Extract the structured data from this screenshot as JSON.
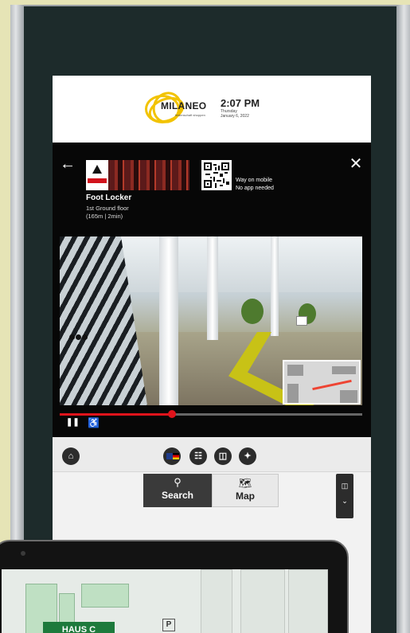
{
  "header": {
    "brand": "MILANEO",
    "brand_tagline": "leidenschaft shoppen",
    "time": "2:07 PM",
    "day": "Thursday",
    "date": "January 6, 2022"
  },
  "store": {
    "name": "Foot Locker",
    "floor": "1st Ground floor",
    "distance": "(165m | 2min)"
  },
  "qr": {
    "line1": "Way on mobile",
    "line2": "No app needed"
  },
  "player": {
    "progress_fraction": 0.37
  },
  "icons": {
    "back": "arrow-left-icon",
    "close": "close-icon",
    "pause": "pause-icon",
    "accessible": "wheelchair-icon",
    "home": "home-icon",
    "language": "flag-icon",
    "accessibility_view": "accessibility-icon",
    "elevator": "elevator-icon",
    "restroom": "restroom-icon",
    "search": "search-icon",
    "map": "map-icon"
  },
  "tabs": {
    "search_label": "Search",
    "map_label": "Map"
  },
  "tablet": {
    "building_label": "HAUS C",
    "parking_label": "P"
  },
  "colors": {
    "accent_red": "#e0131b",
    "logo_yellow": "#f2c300",
    "dark_panel": "#070707",
    "building_green": "#1d7a3c"
  }
}
